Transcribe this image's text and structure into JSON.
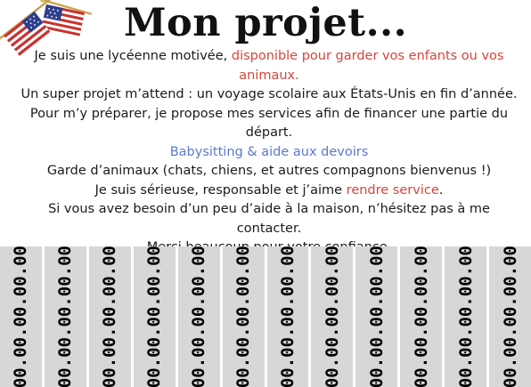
{
  "title": "Mon projet...",
  "intro": {
    "prefix": "Je suis une lycéenne motivée, ",
    "highlight": "disponible pour garder vos enfants ou vos animaux."
  },
  "project": "Un super projet m’attend : un voyage scolaire aux États-Unis en fin d’année.",
  "financing": "Pour m’y préparer, je propose mes services afin de financer une partie du départ.",
  "service_1": "Babysitting & aide aux devoirs",
  "service_2": "Garde d’animaux (chats, chiens, et autres compagnons bienvenus !)",
  "quality": {
    "prefix": "Je suis sérieuse, responsable et j’aime ",
    "highlight": "rendre service",
    "suffix": "."
  },
  "contact": "Si vous avez besoin d’un peu d’aide à la maison, n’hésitez pas à me contacter.",
  "thanks": "Merci beaucoup pour votre confiance.",
  "colors": {
    "highlight_red": "#d6453a",
    "highlight_blue": "#5a78d0",
    "tab_background": "#d7d7d7"
  },
  "decoration": "us-flag-icon",
  "tear_tabs": [
    "00.00.00.00.00",
    "00.00.00.00.00",
    "00.00.00.00.00",
    "00.00.00.00.00",
    "00.00.00.00.00",
    "00.00.00.00.00",
    "00.00.00.00.00",
    "00.00.00.00.00",
    "00.00.00.00.00",
    "00.00.00.00.00",
    "00.00.00.00.00",
    "00.00.00.00.00"
  ]
}
